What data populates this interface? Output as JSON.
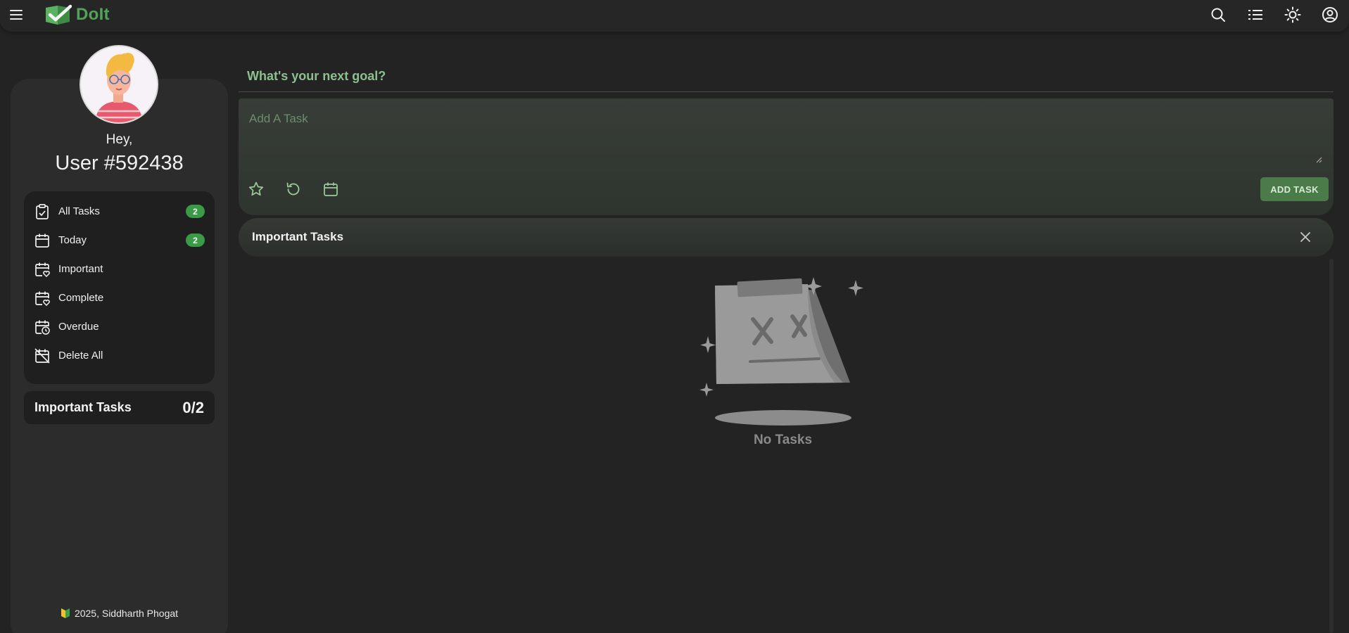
{
  "app": {
    "name": "DoIt",
    "brand_color": "#52a35a",
    "accent_button_color": "#4a7b49",
    "badge_color": "#3a9b46"
  },
  "topbar": {
    "icons": [
      "menu-icon",
      "search-icon",
      "list-view-icon",
      "sun-icon",
      "account-icon"
    ]
  },
  "sidebar": {
    "greeting": "Hey,",
    "username": "User #592438",
    "nav": [
      {
        "label": "All Tasks",
        "icon": "clipboard-check-icon",
        "count": "2"
      },
      {
        "label": "Today",
        "icon": "calendar-icon",
        "count": "2"
      },
      {
        "label": "Important",
        "icon": "calendar-heart-icon",
        "count": ""
      },
      {
        "label": "Complete",
        "icon": "calendar-heart-icon",
        "count": ""
      },
      {
        "label": "Overdue",
        "icon": "calendar-clock-icon",
        "count": ""
      },
      {
        "label": "Delete All",
        "icon": "calendar-delete-icon",
        "count": ""
      }
    ],
    "important_card": {
      "label": "Important Tasks",
      "count": "0/2"
    },
    "footer": "2025, Siddharth Phogat"
  },
  "main": {
    "goal_title": "What's your next goal?",
    "task_input": {
      "placeholder": "Add A Task",
      "value": ""
    },
    "tools": [
      "star-icon",
      "repeat-icon",
      "calendar-icon"
    ],
    "add_button": "ADD TASK",
    "section_title": "Important Tasks",
    "empty_text": "No Tasks"
  }
}
